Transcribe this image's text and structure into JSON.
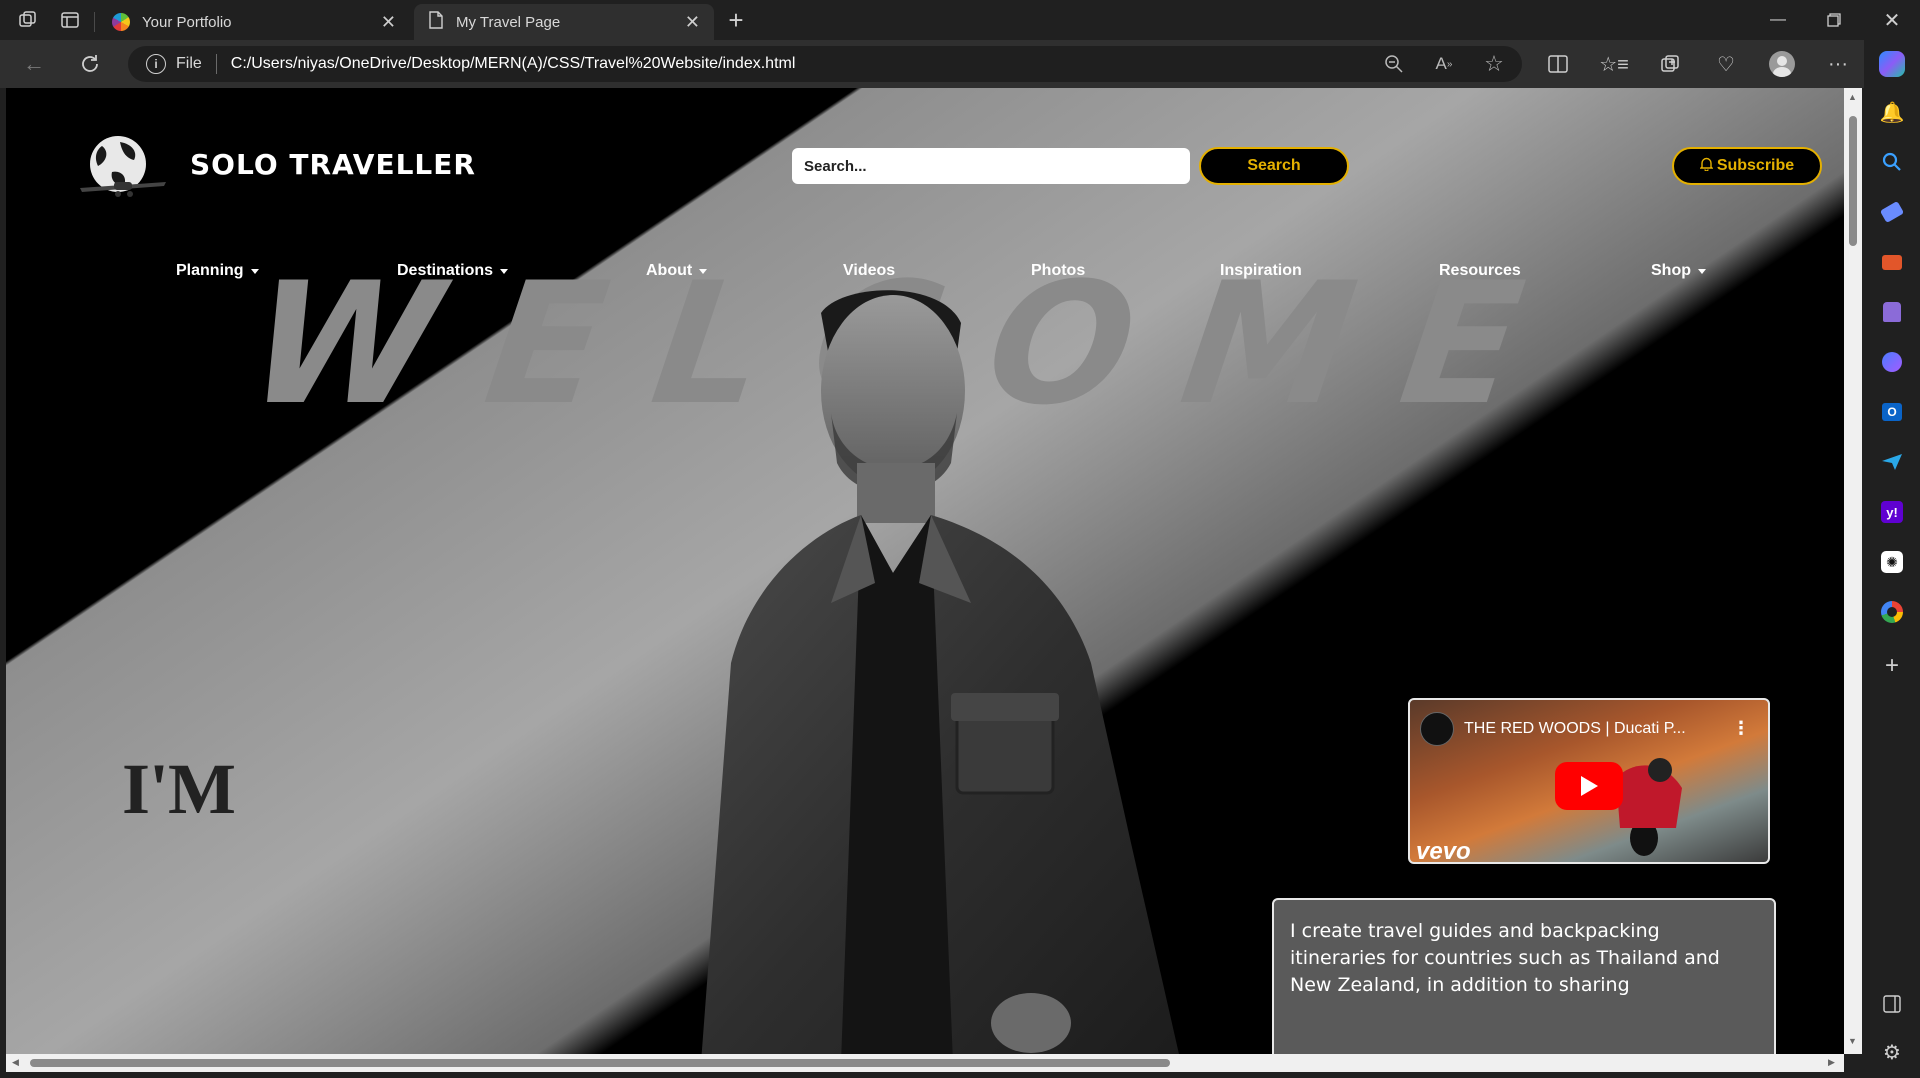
{
  "browser": {
    "tabs": [
      {
        "label": "Your Portfolio",
        "icon": "apple-icon",
        "active": false
      },
      {
        "label": "My Travel Page",
        "icon": "page-icon",
        "active": true
      }
    ],
    "address": {
      "scheme_label": "File",
      "url": "C:/Users/niyas/OneDrive/Desktop/MERN(A)/CSS/Travel%20Website/index.html"
    }
  },
  "page": {
    "brand": "SOLO TRAVELLER",
    "search": {
      "placeholder": "Search...",
      "button_label": "Search"
    },
    "subscribe_label": "Subscribe",
    "nav": [
      {
        "label": "Planning",
        "dropdown": true
      },
      {
        "label": "Destinations",
        "dropdown": true
      },
      {
        "label": "About",
        "dropdown": true
      },
      {
        "label": "Videos",
        "dropdown": false
      },
      {
        "label": "Photos",
        "dropdown": false
      },
      {
        "label": "Inspiration",
        "dropdown": false
      },
      {
        "label": "Resources",
        "dropdown": false
      },
      {
        "label": "Shop",
        "dropdown": true
      }
    ],
    "hero_word": "WELCOME",
    "intro_word": "I'M",
    "video": {
      "title": "THE RED WOODS | Ducati P...",
      "watermark": "vevo"
    },
    "bio": "I create travel guides and backpacking itineraries for countries such as Thailand and New Zealand, in addition to sharing"
  },
  "colors": {
    "accent": "#e4b000",
    "page_bg": "#000000",
    "chrome_bg": "#202020"
  }
}
